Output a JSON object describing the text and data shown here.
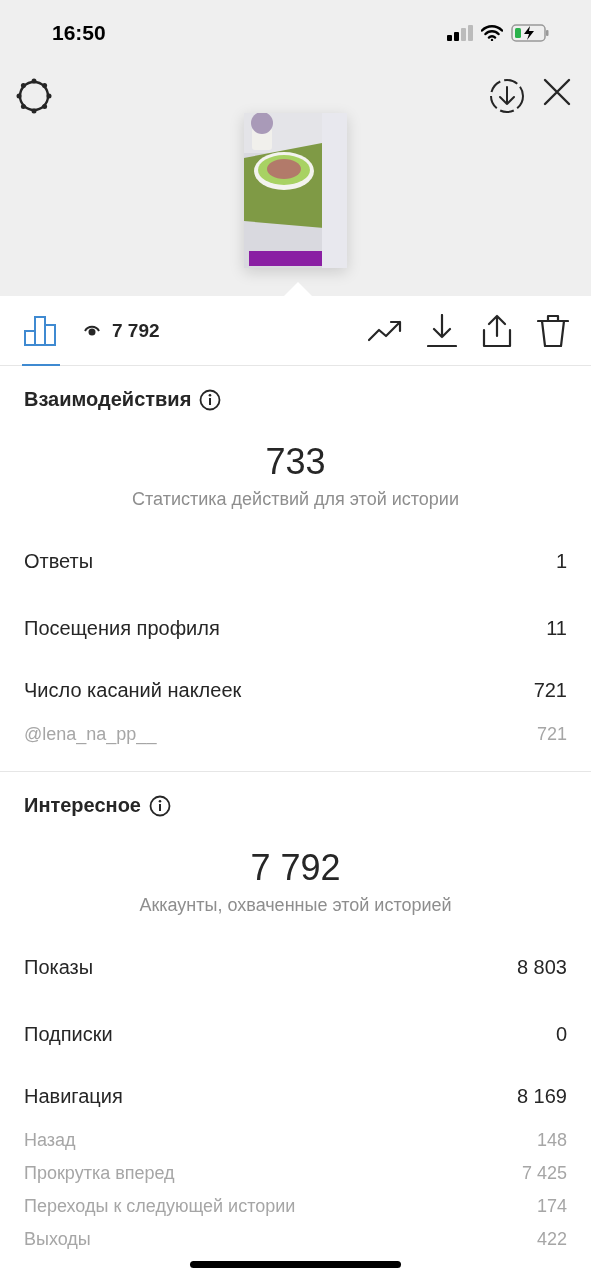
{
  "status_bar": {
    "time": "16:50",
    "battery_charging": true
  },
  "tabs": [
    {
      "kind": "insights",
      "selected": true
    }
  ],
  "view_count": "7 792",
  "sections": [
    {
      "title": "Взаимодействия",
      "total": "733",
      "caption": "Статистика действий для этой истории",
      "rows": [
        {
          "kind": "main",
          "label": "Ответы",
          "value": "1"
        },
        {
          "kind": "main",
          "label": "Посещения профиля",
          "value": "11"
        },
        {
          "kind": "group",
          "label": "Число касаний наклеек",
          "value": "721"
        },
        {
          "kind": "sub",
          "label": "@lena_na_pp__",
          "value": "721"
        }
      ]
    },
    {
      "title": "Интересное",
      "total": "7 792",
      "caption": "Аккаунты, охваченные этой историей",
      "rows": [
        {
          "kind": "main",
          "label": "Показы",
          "value": "8 803"
        },
        {
          "kind": "main",
          "label": "Подписки",
          "value": "0"
        },
        {
          "kind": "group",
          "label": "Навигация",
          "value": "8 169"
        },
        {
          "kind": "sub",
          "label": "Назад",
          "value": "148"
        },
        {
          "kind": "sub",
          "label": "Прокрутка вперед",
          "value": "7 425"
        },
        {
          "kind": "sub",
          "label": "Переходы к следующей истории",
          "value": "174"
        },
        {
          "kind": "sub",
          "label": "Выходы",
          "value": "422"
        }
      ]
    }
  ]
}
